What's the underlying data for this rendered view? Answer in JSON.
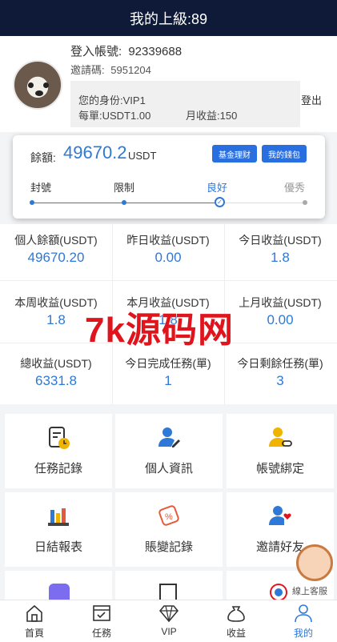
{
  "header": {
    "title": "我的上級:89"
  },
  "profile": {
    "login_label": "登入帳號:",
    "login_value": "92339688",
    "invite_label": "邀請碼:",
    "invite_value": "5951204",
    "identity": "您的身份:VIP1",
    "per_order": "每單:USDT1.00",
    "monthly": "月收益:150",
    "logout": "登出"
  },
  "balance": {
    "label": "餘額:",
    "value": "49670.2",
    "unit": "USDT",
    "fund_button": "基金理财",
    "wallet_button": "我的錢包",
    "levels": [
      "封號",
      "限制",
      "良好",
      "優秀"
    ],
    "current_level": "良好"
  },
  "stats": [
    {
      "label": "個人餘額(USDT)",
      "value": "49670.20"
    },
    {
      "label": "昨日收益(USDT)",
      "value": "0.00"
    },
    {
      "label": "今日收益(USDT)",
      "value": "1.8"
    },
    {
      "label": "本周收益(USDT)",
      "value": "1.8"
    },
    {
      "label": "本月收益(USDT)",
      "value": "1.8"
    },
    {
      "label": "上月收益(USDT)",
      "value": "0.00"
    },
    {
      "label": "總收益(USDT)",
      "value": "6331.8"
    },
    {
      "label": "今日完成任務(單)",
      "value": "1"
    },
    {
      "label": "今日剩餘任務(單)",
      "value": "3"
    }
  ],
  "watermark": "7k源码网",
  "menu": [
    {
      "label": "任務記錄",
      "icon": "task-record-icon"
    },
    {
      "label": "個人資訊",
      "icon": "personal-info-icon"
    },
    {
      "label": "帳號綁定",
      "icon": "account-bind-icon"
    },
    {
      "label": "日結報表",
      "icon": "daily-report-icon"
    },
    {
      "label": "賬變記錄",
      "icon": "balance-change-icon"
    },
    {
      "label": "邀請好友",
      "icon": "invite-friend-icon"
    }
  ],
  "support": {
    "label": "線上客服"
  },
  "tabs": [
    {
      "label": "首頁",
      "icon": "home-icon"
    },
    {
      "label": "任務",
      "icon": "task-icon"
    },
    {
      "label": "VIP",
      "icon": "diamond-icon"
    },
    {
      "label": "收益",
      "icon": "money-bag-icon"
    },
    {
      "label": "我的",
      "icon": "user-icon"
    }
  ],
  "colors": {
    "accent": "#2e78d7",
    "header_bg": "#0e1a38",
    "watermark": "#e0141c"
  }
}
